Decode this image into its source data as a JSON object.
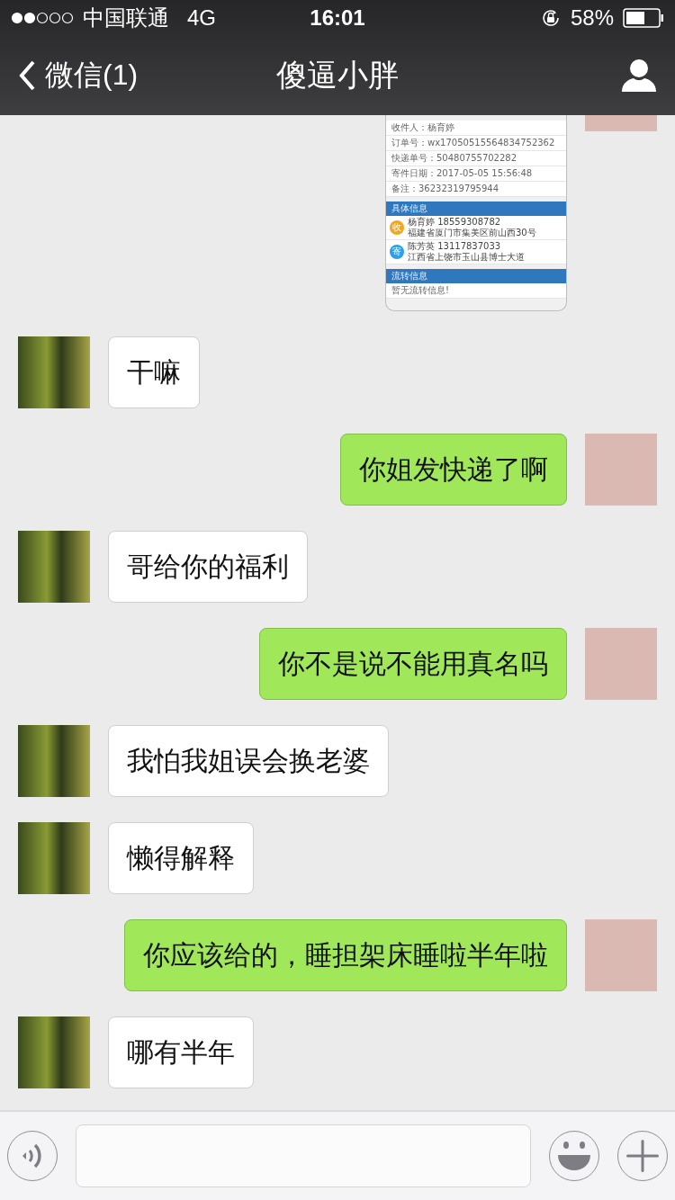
{
  "status_bar": {
    "carrier": "中国联通",
    "network": "4G",
    "time": "16:01",
    "battery": "58%"
  },
  "nav_bar": {
    "back_label": "微信(1)",
    "title": "傻逼小胖"
  },
  "messages": [
    {
      "kind": "image",
      "outgoing": true,
      "image": {
        "fields": [
          "收件人：杨育婷",
          "订单号：wx17050515564834752362",
          "快递单号：50480755702282",
          "寄件日期：2017-05-05 15:56:48",
          "备注：36232319795944"
        ],
        "details_header": "具体信息",
        "contacts": [
          {
            "badge": "收",
            "color": "#f2a81d",
            "line1": "杨育婷 18559308782",
            "line2": "福建省厦门市集美区前山西30号"
          },
          {
            "badge": "寄",
            "color": "#2d9fe6",
            "line1": "陈芳英 13117837033",
            "line2": "江西省上饶市玉山县博士大道"
          }
        ],
        "transit_header": "流转信息",
        "transit_note": "暂无流转信息!"
      }
    },
    {
      "kind": "text",
      "outgoing": false,
      "text": "干嘛"
    },
    {
      "kind": "text",
      "outgoing": true,
      "text": "你姐发快递了啊"
    },
    {
      "kind": "text",
      "outgoing": false,
      "text": "哥给你的福利"
    },
    {
      "kind": "text",
      "outgoing": true,
      "text": "你不是说不能用真名吗"
    },
    {
      "kind": "text",
      "outgoing": false,
      "text": "我怕我姐误会换老婆"
    },
    {
      "kind": "text",
      "outgoing": false,
      "text": "懒得解释"
    },
    {
      "kind": "text",
      "outgoing": true,
      "text": "你应该给的，睡担架床睡啦半年啦"
    },
    {
      "kind": "text",
      "outgoing": false,
      "text": "哪有半年"
    }
  ]
}
